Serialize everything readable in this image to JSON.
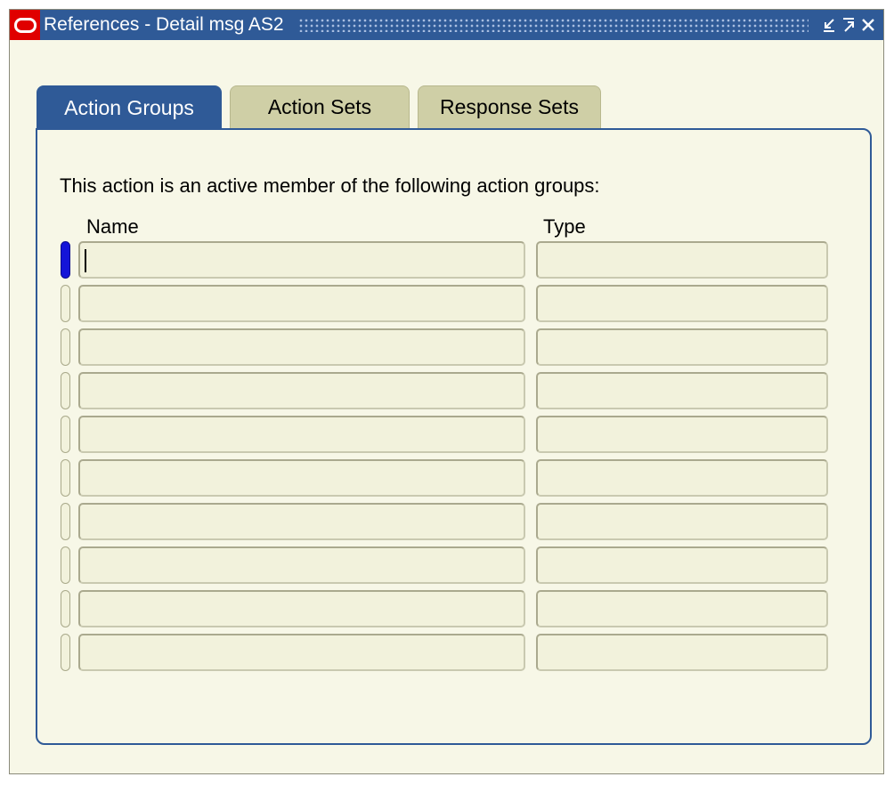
{
  "window": {
    "title": "References - Detail msg AS2"
  },
  "controls": {
    "minimize_icon": "minimize-icon",
    "maximize_icon": "maximize-icon",
    "close_icon": "close-icon"
  },
  "tabs": [
    {
      "label": "Action Groups",
      "active": true
    },
    {
      "label": "Action Sets",
      "active": false
    },
    {
      "label": "Response Sets",
      "active": false
    }
  ],
  "panel": {
    "prompt": "This action is an active member of the following action groups:",
    "columns": {
      "name": "Name",
      "type": "Type"
    },
    "rows": [
      {
        "name": "",
        "type": ""
      },
      {
        "name": "",
        "type": ""
      },
      {
        "name": "",
        "type": ""
      },
      {
        "name": "",
        "type": ""
      },
      {
        "name": "",
        "type": ""
      },
      {
        "name": "",
        "type": ""
      },
      {
        "name": "",
        "type": ""
      },
      {
        "name": "",
        "type": ""
      },
      {
        "name": "",
        "type": ""
      },
      {
        "name": "",
        "type": ""
      }
    ],
    "current_row": 1
  },
  "colors": {
    "title_bar": "#2f5a97",
    "window_bg": "#f7f7e7",
    "inactive_tab": "#cfcfa6",
    "current_record_indicator": "#1414d8",
    "logo": "#e00000"
  }
}
